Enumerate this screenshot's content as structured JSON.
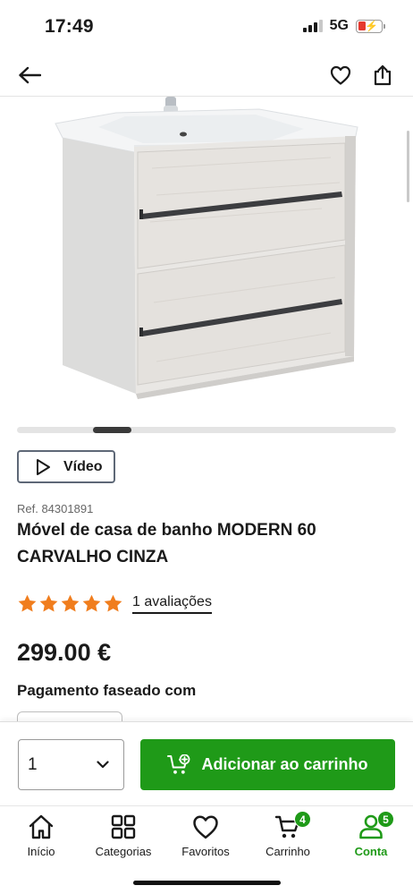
{
  "status_bar": {
    "time": "17:49",
    "network": "5G",
    "battery_level": "low",
    "battery_color": "#e5392f"
  },
  "nav": {
    "back_icon": "arrow-left-icon",
    "favorite_icon": "heart-icon",
    "share_icon": "share-icon"
  },
  "gallery": {
    "image_subject": "bathroom vanity cabinet with two drawers and white basin",
    "active_slide_fraction": 0.2
  },
  "video_button": {
    "label": "Vídeo",
    "icon": "play-icon"
  },
  "product": {
    "ref": "Ref. 84301891",
    "title": "Móvel de casa de banho MODERN 60 CARVALHO CINZA",
    "rating": 5,
    "rating_max": 5,
    "star_color": "#f07d1d",
    "reviews_label": "1 avaliações",
    "price": "299.00 €",
    "installment_label": "Pagamento faseado com"
  },
  "buy_bar": {
    "quantity": "1",
    "add_to_cart_label": "Adicionar ao carrinho",
    "cart_icon": "cart-plus-icon",
    "accent_color": "#1f9a18"
  },
  "tab_bar": {
    "tabs": [
      {
        "label": "Início",
        "icon": "home-icon",
        "badge": "",
        "active": false
      },
      {
        "label": "Categorias",
        "icon": "grid-icon",
        "badge": "",
        "active": false
      },
      {
        "label": "Favoritos",
        "icon": "heart-icon",
        "badge": "",
        "active": false
      },
      {
        "label": "Carrinho",
        "icon": "cart-icon",
        "badge": "4",
        "active": false
      },
      {
        "label": "Conta",
        "icon": "user-icon",
        "badge": "5",
        "active": true
      }
    ]
  }
}
